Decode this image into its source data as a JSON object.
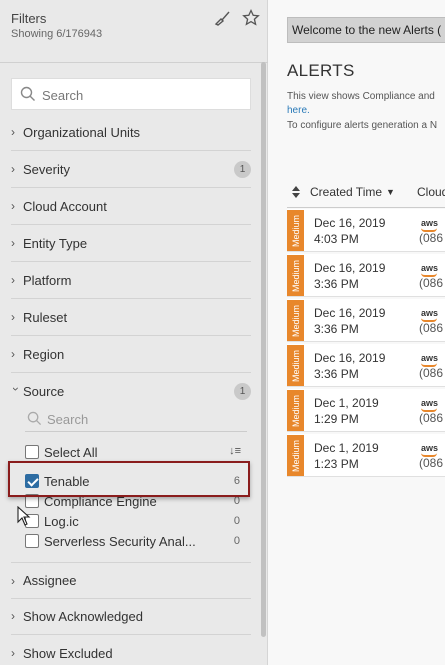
{
  "sidebar": {
    "title": "Filters",
    "showing": "Showing 6/176943",
    "search_placeholder": "Search",
    "facets": [
      {
        "label": "Organizational Units",
        "expanded": false
      },
      {
        "label": "Severity",
        "expanded": false,
        "badge": "1"
      },
      {
        "label": "Cloud Account",
        "expanded": false
      },
      {
        "label": "Entity Type",
        "expanded": false
      },
      {
        "label": "Platform",
        "expanded": false
      },
      {
        "label": "Ruleset",
        "expanded": false
      },
      {
        "label": "Region",
        "expanded": false
      },
      {
        "label": "Source",
        "expanded": true,
        "badge": "1"
      }
    ],
    "source": {
      "search_placeholder": "Search",
      "select_all": "Select All",
      "options": [
        {
          "label": "Tenable",
          "count": "6",
          "checked": true
        },
        {
          "label": "Compliance Engine",
          "count": "0",
          "checked": false
        },
        {
          "label": "Log.ic",
          "count": "0",
          "checked": false
        },
        {
          "label": "Serverless Security Anal...",
          "count": "0",
          "checked": false
        }
      ]
    },
    "facets_after": [
      {
        "label": "Assignee"
      },
      {
        "label": "Show Acknowledged"
      },
      {
        "label": "Show Excluded"
      }
    ]
  },
  "main": {
    "banner": "Welcome to the new Alerts (",
    "heading": "ALERTS",
    "desc_line1": "This view shows Compliance and",
    "desc_link": "here.",
    "desc_line2": "To configure alerts generation a N",
    "columns": {
      "created": "Created Time",
      "cloud": "Cloud"
    },
    "rows": [
      {
        "severity": "Medium",
        "date": "Dec 16, 2019 4:03 PM",
        "cloud": "aws",
        "account": "(086"
      },
      {
        "severity": "Medium",
        "date": "Dec 16, 2019 3:36 PM",
        "cloud": "aws",
        "account": "(086"
      },
      {
        "severity": "Medium",
        "date": "Dec 16, 2019 3:36 PM",
        "cloud": "aws",
        "account": "(086"
      },
      {
        "severity": "Medium",
        "date": "Dec 16, 2019 3:36 PM",
        "cloud": "aws",
        "account": "(086"
      },
      {
        "severity": "Medium",
        "date": "Dec 1, 2019 1:29 PM",
        "cloud": "aws",
        "account": "(086"
      },
      {
        "severity": "Medium",
        "date": "Dec 1, 2019 1:23 PM",
        "cloud": "aws",
        "account": "(086"
      }
    ]
  },
  "colors": {
    "severity_medium": "#e8872b",
    "checkbox_checked": "#2d6ca2",
    "highlight": "#8a1c1c"
  }
}
